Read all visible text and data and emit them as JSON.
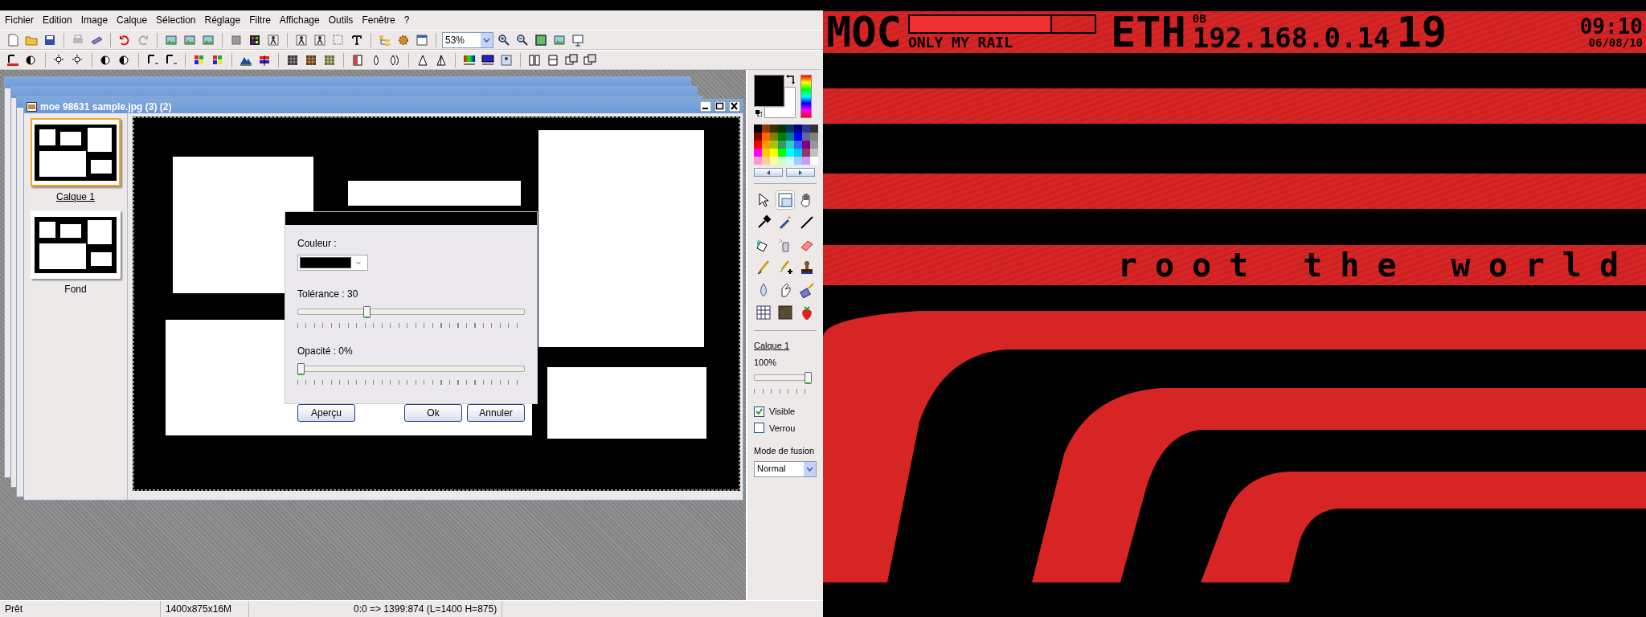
{
  "menu": [
    "Fichier",
    "Edition",
    "Image",
    "Calque",
    "Sélection",
    "Réglage",
    "Filtre",
    "Affichage",
    "Outils",
    "Fenêtre",
    "?"
  ],
  "zoom_value": "53%",
  "document": {
    "title": "moe 98631 sample.jpg (3) (2)"
  },
  "layers": [
    {
      "name": "Calque 1",
      "selected": true
    },
    {
      "name": "Fond",
      "selected": false
    }
  ],
  "dialog": {
    "color_label": "Couleur :",
    "color": "#000000",
    "sliders": [
      {
        "label": "Tolérance : 30",
        "level": 0.3
      },
      {
        "label": "Opacité : 0%",
        "level": 0
      }
    ],
    "buttons": [
      {
        "label": "Aperçu"
      },
      {
        "label": "Ok"
      },
      {
        "label": "Annuler"
      }
    ]
  },
  "tool_panel": {
    "color_slots": [
      {
        "color": "#000000"
      },
      {
        "color": "#ffffff"
      }
    ],
    "palette": [
      {
        "color": "#000000"
      },
      {
        "color": "#993300"
      },
      {
        "color": "#333300"
      },
      {
        "color": "#003300"
      },
      {
        "color": "#003366"
      },
      {
        "color": "#000080"
      },
      {
        "color": "#333399"
      },
      {
        "color": "#333333"
      },
      {
        "color": "#800000"
      },
      {
        "color": "#ff6600"
      },
      {
        "color": "#808000"
      },
      {
        "color": "#008000"
      },
      {
        "color": "#008080"
      },
      {
        "color": "#0000ff"
      },
      {
        "color": "#666699"
      },
      {
        "color": "#808080"
      },
      {
        "color": "#ff0000"
      },
      {
        "color": "#ff9900"
      },
      {
        "color": "#99cc00"
      },
      {
        "color": "#339966"
      },
      {
        "color": "#33cccc"
      },
      {
        "color": "#3366ff"
      },
      {
        "color": "#800080"
      },
      {
        "color": "#969696"
      },
      {
        "color": "#ff00ff"
      },
      {
        "color": "#ffcc00"
      },
      {
        "color": "#ffff00"
      },
      {
        "color": "#00ff00"
      },
      {
        "color": "#00ffff"
      },
      {
        "color": "#00ccff"
      },
      {
        "color": "#993366"
      },
      {
        "color": "#c0c0c0"
      },
      {
        "color": "#ff99cc"
      },
      {
        "color": "#ffcc99"
      },
      {
        "color": "#ffff99"
      },
      {
        "color": "#ccffcc"
      },
      {
        "color": "#ccffff"
      },
      {
        "color": "#99ccff"
      },
      {
        "color": "#cc99ff"
      },
      {
        "color": "#ffffff"
      }
    ],
    "tools": [
      {
        "selected": false
      },
      {
        "selected": true
      },
      {
        "selected": false
      },
      {
        "selected": false
      },
      {
        "selected": false
      },
      {
        "selected": false
      },
      {
        "selected": false
      },
      {
        "selected": false
      },
      {
        "selected": false
      },
      {
        "selected": false
      },
      {
        "selected": false
      },
      {
        "selected": false
      },
      {
        "selected": false
      },
      {
        "selected": false
      },
      {
        "selected": false
      },
      {
        "selected": false
      },
      {
        "selected": false
      },
      {
        "selected": false
      }
    ],
    "layer_name": "Calque 1",
    "opacity": {
      "reading": "100%",
      "level": 1
    },
    "checkboxes": [
      {
        "label": "Visible",
        "checked": true
      },
      {
        "label": "Verrou",
        "checked": false
      }
    ],
    "blend_label": "Mode de fusion",
    "blend_value": "Normal"
  },
  "status_bar": [
    "Prêt",
    "1400x875x16M",
    "0:0 => 1399:874 (L=1400  H=875)"
  ],
  "desktop": {
    "player": "MOC",
    "track": "ONLY MY RAIL",
    "progress": {
      "level": 0.77
    },
    "net_label": "ETH",
    "net_rate": "0B",
    "ip": "192.168.0.14",
    "number": "19",
    "time": "09:10",
    "date": "06/08/10",
    "slogan": "root the world"
  }
}
